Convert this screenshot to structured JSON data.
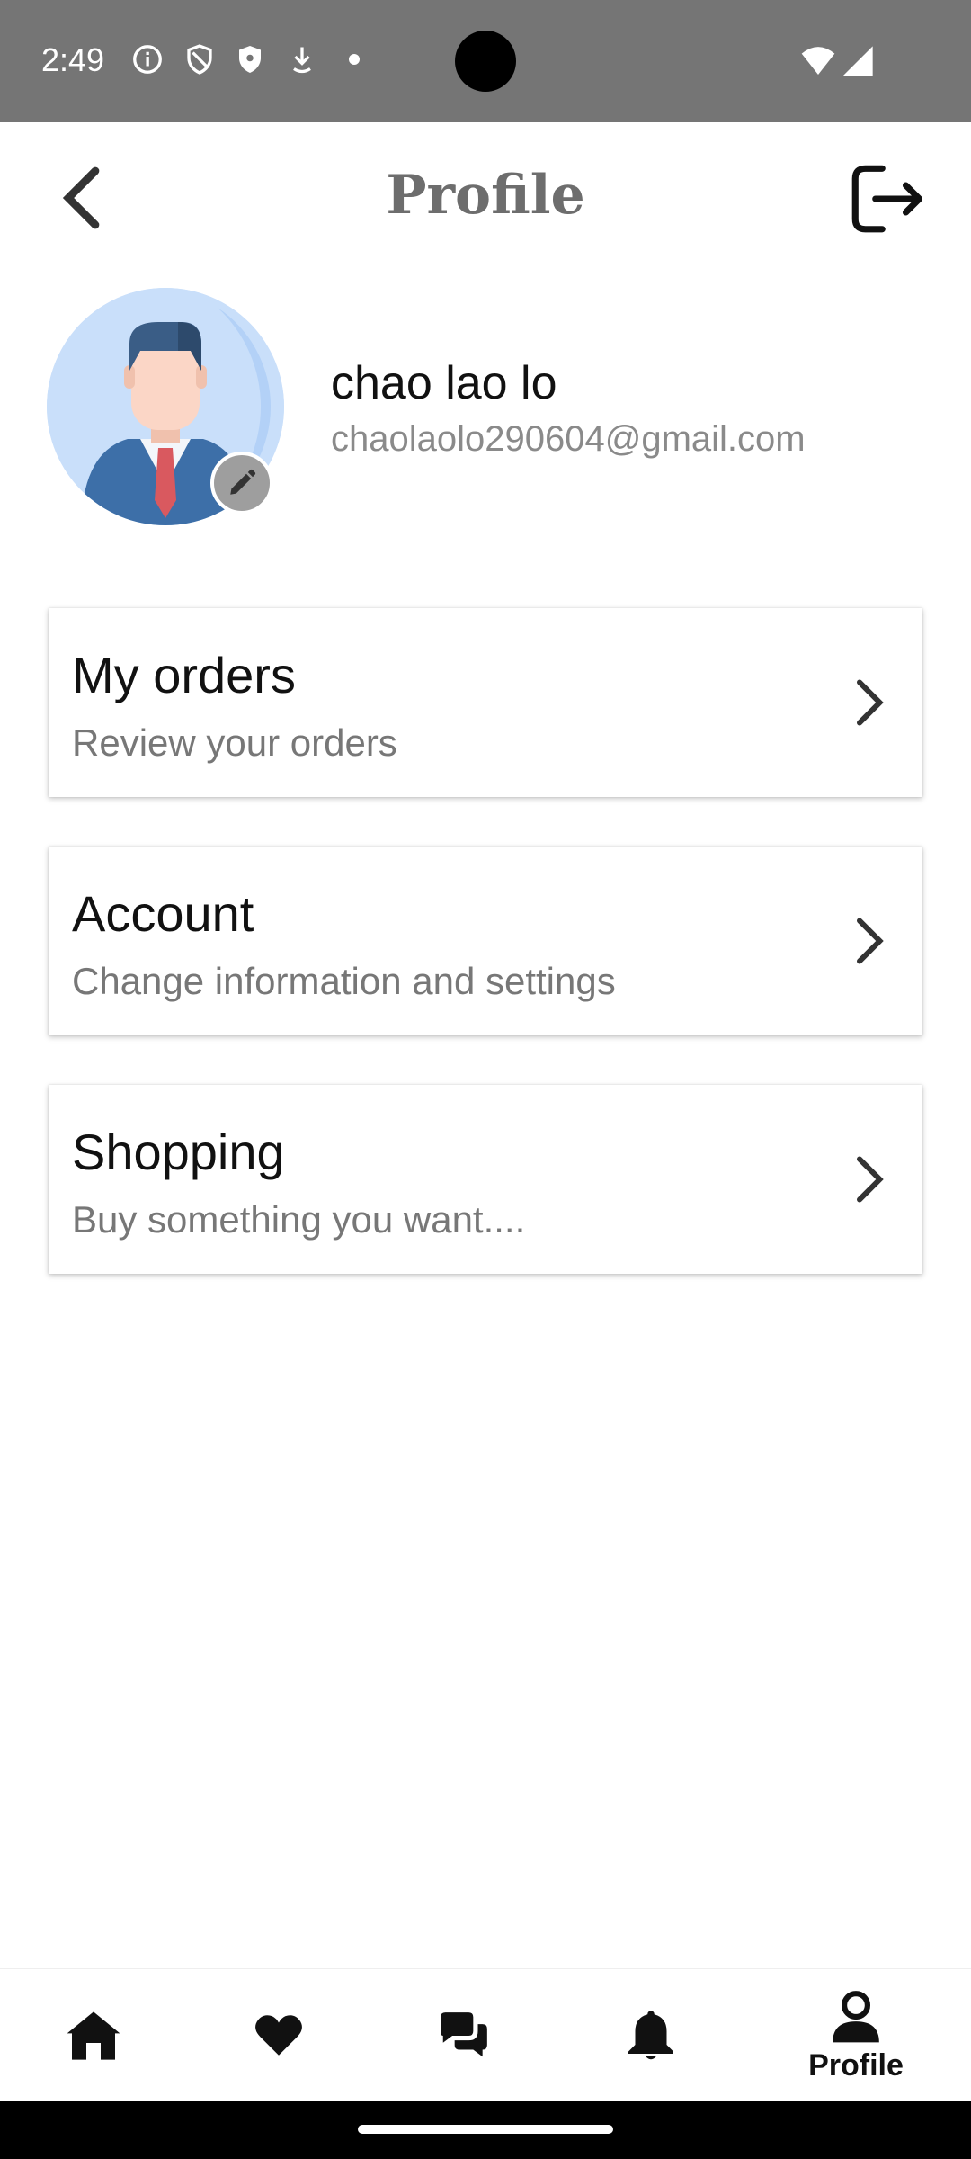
{
  "status_bar": {
    "time": "2:49",
    "icons": [
      "info-icon",
      "shield-icon",
      "shield-filled-icon",
      "download-icon",
      "dot-icon",
      "wifi-icon",
      "signal-icon"
    ]
  },
  "header": {
    "title": "Profile",
    "back_icon": "chevron-left-icon",
    "logout_icon": "logout-icon"
  },
  "profile": {
    "name": "chao lao lo",
    "email": "chaolaolo290604@gmail.com",
    "avatar_icon": "businessman-avatar",
    "edit_icon": "pencil-icon"
  },
  "menu": [
    {
      "title": "My orders",
      "subtitle": "Review your orders"
    },
    {
      "title": "Account",
      "subtitle": "Change information and settings"
    },
    {
      "title": "Shopping",
      "subtitle": "Buy something you want...."
    }
  ],
  "bottom_nav": {
    "items": [
      {
        "icon": "home-icon"
      },
      {
        "icon": "heart-icon"
      },
      {
        "icon": "chat-icon"
      },
      {
        "icon": "bell-icon"
      },
      {
        "icon": "person-icon",
        "label": "Profile",
        "active": true
      }
    ]
  },
  "colors": {
    "status_bar": "#757575",
    "title": "#6d6d6d",
    "subtitle": "#777777",
    "avatar_bg": "#c9dffa"
  }
}
